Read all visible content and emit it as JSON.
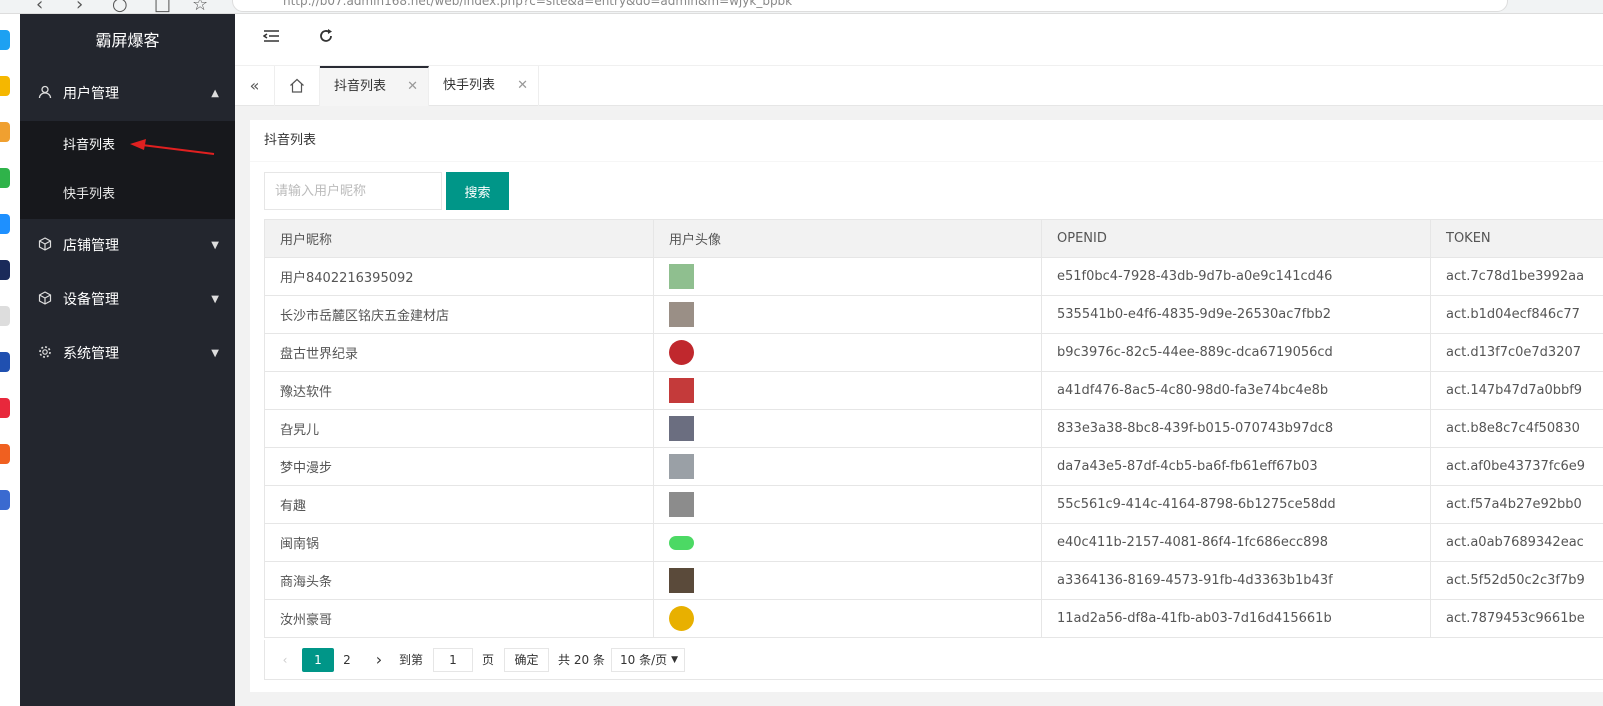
{
  "browser": {
    "address": "http://b07.admin168.net/web/index.php?c=site&a=entry&do=admin&m=wjyk_bpbk"
  },
  "sidebar": {
    "brand": "霸屏爆客",
    "menus": [
      {
        "label": "用户管理",
        "icon": "user-icon",
        "expanded": true,
        "children": [
          {
            "label": "抖音列表",
            "active": true
          },
          {
            "label": "快手列表"
          }
        ]
      },
      {
        "label": "店铺管理",
        "icon": "cube-icon"
      },
      {
        "label": "设备管理",
        "icon": "cube-icon"
      },
      {
        "label": "系统管理",
        "icon": "gear-icon"
      }
    ]
  },
  "header": {
    "icons": [
      "menu-fold-icon",
      "refresh-icon"
    ]
  },
  "tabs": [
    {
      "label": "抖音列表",
      "active": true
    },
    {
      "label": "快手列表"
    }
  ],
  "card": {
    "title": "抖音列表",
    "search": {
      "placeholder": "请输入用户昵称",
      "button": "搜索"
    },
    "columns": [
      "用户昵称",
      "用户头像",
      "OPENID",
      "TOKEN"
    ],
    "rows": [
      {
        "nickname": "用户8402216395092",
        "openid": "e51f0bc4-7928-43db-9d7b-a0e9c141cd46",
        "token": "act.7c78d1be3992aa",
        "avatar_color": "#8fbf8f"
      },
      {
        "nickname": "长沙市岳麓区铭庆五金建材店",
        "openid": "535541b0-e4f6-4835-9d9e-26530ac7fbb2",
        "token": "act.b1d04ecf846c77",
        "avatar_color": "#9a8f86"
      },
      {
        "nickname": "盘古世界纪录",
        "openid": "b9c3976c-82c5-44ee-889c-dca6719056cd",
        "token": "act.d13f7c0e7d3207",
        "avatar_color": "#c0282d"
      },
      {
        "nickname": "豫达软件",
        "openid": "a41df476-8ac5-4c80-98d0-fa3e74bc4e8b",
        "token": "act.147b47d7a0bbf9",
        "avatar_color": "#c43a3a"
      },
      {
        "nickname": "旮旯儿",
        "openid": "833e3a38-8bc8-439f-b015-070743b97dc8",
        "token": "act.b8e8c7c4f50830",
        "avatar_color": "#6b6e80"
      },
      {
        "nickname": "梦中漫步",
        "openid": "da7a43e5-87df-4cb5-ba6f-fb61eff67b03",
        "token": "act.af0be43737fc6e9",
        "avatar_color": "#9aa0a6"
      },
      {
        "nickname": "有趣",
        "openid": "55c561c9-414c-4164-8798-6b1275ce58dd",
        "token": "act.f57a4b27e92bb0",
        "avatar_color": "#8c8c8c"
      },
      {
        "nickname": "闽南锅",
        "openid": "e40c411b-2157-4081-86f4-1fc686ecc898",
        "token": "act.a0ab7689342eac",
        "avatar_color": "#4cd964"
      },
      {
        "nickname": "商海头条",
        "openid": "a3364136-8169-4573-91fb-4d3363b1b43f",
        "token": "act.5f52d50c2c3f7b9",
        "avatar_color": "#5a4a3a"
      },
      {
        "nickname": "汝州豪哥",
        "openid": "11ad2a56-df8a-41fb-ab03-7d16d415661b",
        "token": "act.7879453c9661be",
        "avatar_color": "#e8b000"
      }
    ],
    "pagination": {
      "pages": [
        "1",
        "2"
      ],
      "current": "1",
      "goto_prefix": "到第",
      "goto_value": "1",
      "goto_suffix": "页",
      "confirm": "确定",
      "total": "共 20 条",
      "page_size": "10 条/页"
    }
  }
}
